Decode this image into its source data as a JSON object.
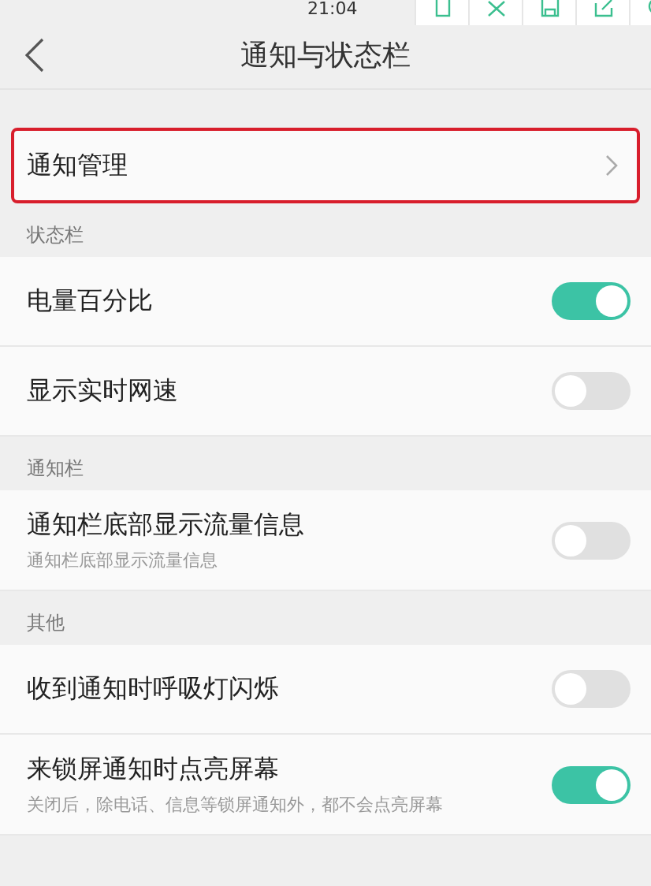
{
  "status_bar": {
    "time": "21:04"
  },
  "header": {
    "title": "通知与状态栏"
  },
  "highlight_row": {
    "label": "通知管理"
  },
  "sections": [
    {
      "title": "状态栏",
      "items": [
        {
          "label": "电量百分比",
          "on": true
        },
        {
          "label": "显示实时网速",
          "on": false
        }
      ]
    },
    {
      "title": "通知栏",
      "items": [
        {
          "label": "通知栏底部显示流量信息",
          "subtitle": "通知栏底部显示流量信息",
          "on": false
        }
      ]
    },
    {
      "title": "其他",
      "items": [
        {
          "label": "收到通知时呼吸灯闪烁",
          "on": false
        },
        {
          "label": "来锁屏通知时点亮屏幕",
          "subtitle": "关闭后，除电话、信息等锁屏通知外，都不会点亮屏幕",
          "on": true
        }
      ]
    }
  ]
}
